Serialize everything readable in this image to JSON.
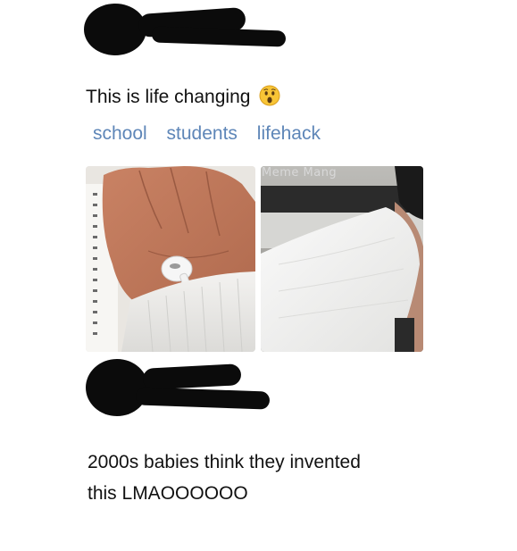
{
  "post": {
    "caption": "This is life changing",
    "emoji": "astonished-face",
    "hashtags": [
      "school",
      "students",
      "lifehack"
    ],
    "watermark": "Meme Mang"
  },
  "reply": {
    "line1": "2000s babies think they invented",
    "line2": "this LMAOOOOOO"
  }
}
